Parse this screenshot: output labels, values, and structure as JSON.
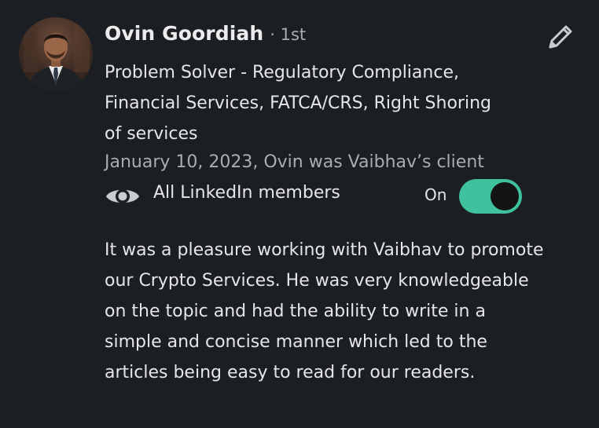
{
  "recommender": {
    "name": "Ovin Goordiah",
    "degree": "· 1st",
    "headline": "Problem Solver - Regulatory Compliance, Financial Services, FATCA/CRS, Right Shoring of services",
    "date_relation": "January 10, 2023, Ovin was Vaibhav’s client"
  },
  "visibility": {
    "icon": "eye-icon",
    "label": "All LinkedIn members",
    "toggle_label": "On",
    "toggle_on": true,
    "toggle_color": "#3ec19c"
  },
  "recommendation": {
    "text": "It was a pleasure working with Vaibhav to promote our Crypto Services. He was very knowledgeable on the topic and had the ability to write in a simple and concise manner which led to the articles being easy to read for our readers."
  },
  "actions": {
    "edit_icon": "pencil-icon"
  },
  "colors": {
    "background": "#1b1f23",
    "primary_text": "#e6e6e6",
    "secondary_text": "#a8adb2"
  }
}
